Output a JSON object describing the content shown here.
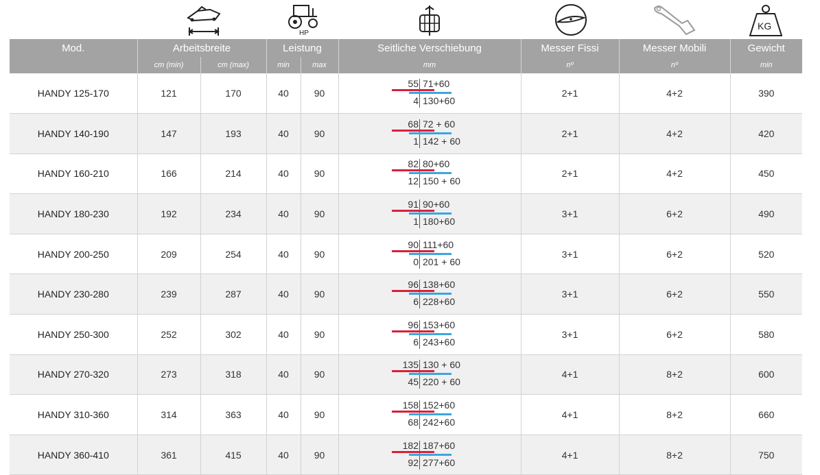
{
  "icons": {
    "arbeitsbreite": "mower-width-icon",
    "leistung": "tractor-icon",
    "leistung_caption": "HP",
    "verschiebung": "offset-shift-icon",
    "messer_fissi": "fixed-blade-icon",
    "messer_mobili": "flail-blade-icon",
    "gewicht": "weight-icon",
    "gewicht_caption": "KG"
  },
  "colors": {
    "header_bg": "#a3a3a3",
    "red_bar": "#d8203a",
    "blue_bar": "#3ba6de",
    "stripe": "#f0f0f0"
  },
  "header": {
    "mod": "Mod.",
    "arbeitsbreite": "Arbeitsbreite",
    "leistung": "Leistung",
    "verschiebung": "Seitliche Verschiebung",
    "messer_fissi": "Messer Fissi",
    "messer_mobili": "Messer Mobili",
    "gewicht": "Gewicht"
  },
  "subheader": {
    "cm_min": "cm (min)",
    "cm_max": "cm (max)",
    "hp_min": "min",
    "hp_max": "max",
    "mm": "mm",
    "fissi_unit": "nº",
    "mobili_unit": "nº",
    "weight_unit": "min"
  },
  "rows": [
    {
      "model": "HANDY 125-170",
      "width_min": "121",
      "width_max": "170",
      "hp_min": "40",
      "hp_max": "90",
      "shift_tl": "55",
      "shift_tr": "71+60",
      "shift_bl": "4",
      "shift_br": "130+60",
      "fissi": "2+1",
      "mobili": "4+2",
      "weight": "390"
    },
    {
      "model": "HANDY 140-190",
      "width_min": "147",
      "width_max": "193",
      "hp_min": "40",
      "hp_max": "90",
      "shift_tl": "68",
      "shift_tr": "72 + 60",
      "shift_bl": "1",
      "shift_br": "142 + 60",
      "fissi": "2+1",
      "mobili": "4+2",
      "weight": "420"
    },
    {
      "model": "HANDY 160-210",
      "width_min": "166",
      "width_max": "214",
      "hp_min": "40",
      "hp_max": "90",
      "shift_tl": "82",
      "shift_tr": "80+60",
      "shift_bl": "12",
      "shift_br": "150 + 60",
      "fissi": "2+1",
      "mobili": "4+2",
      "weight": "450"
    },
    {
      "model": "HANDY 180-230",
      "width_min": "192",
      "width_max": "234",
      "hp_min": "40",
      "hp_max": "90",
      "shift_tl": "91",
      "shift_tr": "90+60",
      "shift_bl": "1",
      "shift_br": "180+60",
      "fissi": "3+1",
      "mobili": "6+2",
      "weight": "490"
    },
    {
      "model": "HANDY 200-250",
      "width_min": "209",
      "width_max": "254",
      "hp_min": "40",
      "hp_max": "90",
      "shift_tl": "90",
      "shift_tr": "111+60",
      "shift_bl": "0",
      "shift_br": "201 + 60",
      "fissi": "3+1",
      "mobili": "6+2",
      "weight": "520"
    },
    {
      "model": "HANDY 230-280",
      "width_min": "239",
      "width_max": "287",
      "hp_min": "40",
      "hp_max": "90",
      "shift_tl": "96",
      "shift_tr": "138+60",
      "shift_bl": "6",
      "shift_br": "228+60",
      "fissi": "3+1",
      "mobili": "6+2",
      "weight": "550"
    },
    {
      "model": "HANDY 250-300",
      "width_min": "252",
      "width_max": "302",
      "hp_min": "40",
      "hp_max": "90",
      "shift_tl": "96",
      "shift_tr": "153+60",
      "shift_bl": "6",
      "shift_br": "243+60",
      "fissi": "3+1",
      "mobili": "6+2",
      "weight": "580"
    },
    {
      "model": "HANDY 270-320",
      "width_min": "273",
      "width_max": "318",
      "hp_min": "40",
      "hp_max": "90",
      "shift_tl": "135",
      "shift_tr": "130 + 60",
      "shift_bl": "45",
      "shift_br": "220 + 60",
      "fissi": "4+1",
      "mobili": "8+2",
      "weight": "600"
    },
    {
      "model": "HANDY 310-360",
      "width_min": "314",
      "width_max": "363",
      "hp_min": "40",
      "hp_max": "90",
      "shift_tl": "158",
      "shift_tr": "152+60",
      "shift_bl": "68",
      "shift_br": "242+60",
      "fissi": "4+1",
      "mobili": "8+2",
      "weight": "660"
    },
    {
      "model": "HANDY 360-410",
      "width_min": "361",
      "width_max": "415",
      "hp_min": "40",
      "hp_max": "90",
      "shift_tl": "182",
      "shift_tr": "187+60",
      "shift_bl": "92",
      "shift_br": "277+60",
      "fissi": "4+1",
      "mobili": "8+2",
      "weight": "750"
    }
  ]
}
